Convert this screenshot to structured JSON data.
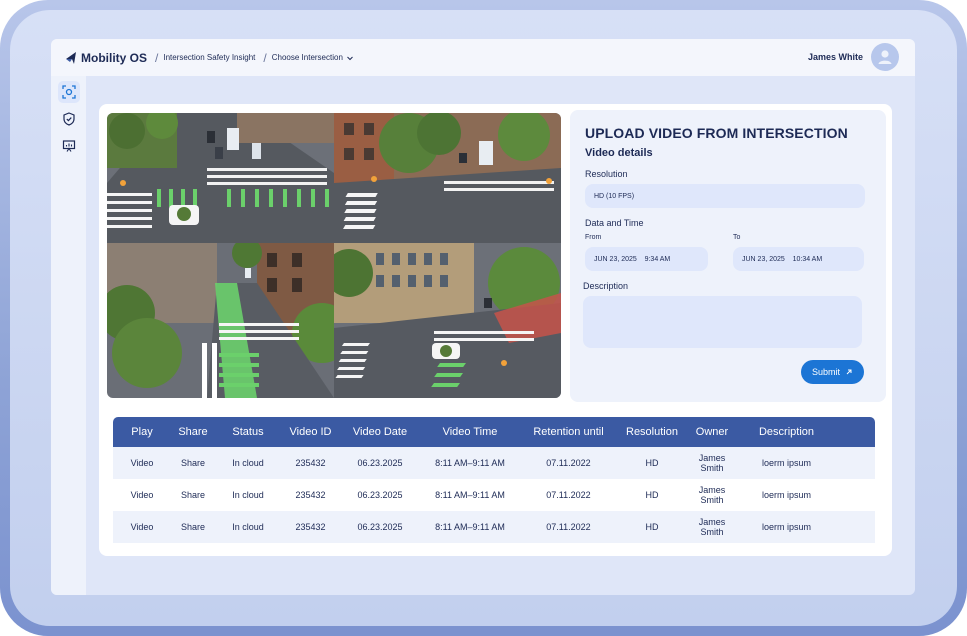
{
  "app": {
    "name": "Mobility OS",
    "breadcrumb": [
      "Intersection Safety Insight",
      "Choose Intersection"
    ]
  },
  "user": {
    "name": "James White"
  },
  "sidebar": {
    "items": [
      {
        "icon": "scan-icon",
        "active": true
      },
      {
        "icon": "shield-icon",
        "active": false
      },
      {
        "icon": "presentation-chart-icon",
        "active": false
      }
    ]
  },
  "upload": {
    "title": "UPLOAD VIDEO FROM INTERSECTION",
    "subtitle": "Video details",
    "resolution_label": "Resolution",
    "resolution_value": "HD (10 FPS)",
    "datetime_label": "Data and Time",
    "from_label": "From",
    "to_label": "To",
    "from_value": "JUN 23, 2025    9:34 AM",
    "to_value": "JUN 23, 2025    10:34 AM",
    "description_label": "Description",
    "description_value": "",
    "submit_label": "Submit"
  },
  "table": {
    "headers": [
      "Play",
      "Share",
      "Status",
      "Video ID",
      "Video Date",
      "Video Time",
      "Retention until",
      "Resolution",
      "Owner",
      "Description"
    ],
    "rows": [
      [
        "Video",
        "Share",
        "In cloud",
        "235432",
        "06.23.2025",
        "8:11 AM–9:11 AM",
        "07.11.2022",
        "HD",
        "James Smith",
        "loerm ipsum"
      ],
      [
        "Video",
        "Share",
        "In cloud",
        "235432",
        "06.23.2025",
        "8:11 AM–9:11 AM",
        "07.11.2022",
        "HD",
        "James Smith",
        "loerm ipsum"
      ],
      [
        "Video",
        "Share",
        "In cloud",
        "235432",
        "06.23.2025",
        "8:11 AM–9:11 AM",
        "07.11.2022",
        "HD",
        "James Smith",
        "loerm ipsum"
      ]
    ]
  },
  "colors": {
    "accent": "#1c75d5",
    "table_header": "#3b5aa3",
    "text": "#1d2a55"
  }
}
